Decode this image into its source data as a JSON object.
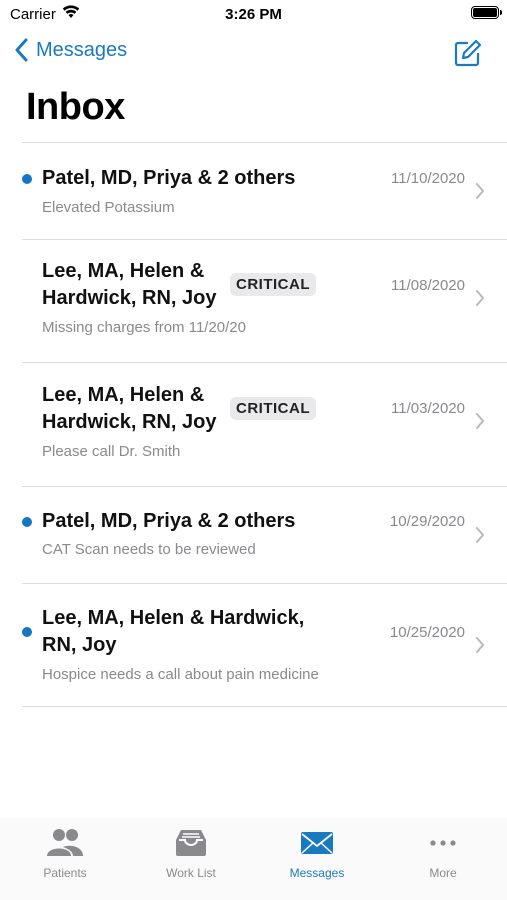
{
  "status_bar": {
    "carrier": "Carrier",
    "time": "3:26 PM"
  },
  "nav": {
    "back_label": "Messages"
  },
  "page_title": "Inbox",
  "messages": [
    {
      "name": "Patel, MD, Priya & 2 others",
      "date": "11/10/2020",
      "preview": "Elevated Potassium",
      "unread": true,
      "badge": ""
    },
    {
      "name_line1": "Lee, MA, Helen &",
      "name_line2": "Hardwick, RN, Joy",
      "date": "11/08/2020",
      "preview": "Missing charges from 11/20/20",
      "unread": false,
      "badge": "CRITICAL"
    },
    {
      "name_line1": "Lee, MA, Helen &",
      "name_line2": "Hardwick, RN, Joy",
      "date": "11/03/2020",
      "preview": "Please call Dr. Smith",
      "unread": false,
      "badge": "CRITICAL"
    },
    {
      "name": "Patel, MD, Priya & 2 others",
      "date": "10/29/2020",
      "preview": "CAT Scan needs to be reviewed",
      "unread": true,
      "badge": ""
    },
    {
      "name_line1": "Lee, MA, Helen & Hardwick,",
      "name_line2": "RN, Joy",
      "date": "10/25/2020",
      "preview": "Hospice needs a call about pain medicine",
      "unread": true,
      "badge": ""
    }
  ],
  "tabs": [
    {
      "label": "Patients",
      "icon": "patients-icon",
      "active": false
    },
    {
      "label": "Work List",
      "icon": "inbox-tray-icon",
      "active": false
    },
    {
      "label": "Messages",
      "icon": "envelope-icon",
      "active": true
    },
    {
      "label": "More",
      "icon": "more-dots-icon",
      "active": false
    }
  ],
  "colors": {
    "accent": "#1a7ac0",
    "unread_dot": "#1477c5",
    "secondary_text": "#8a8a8e"
  }
}
